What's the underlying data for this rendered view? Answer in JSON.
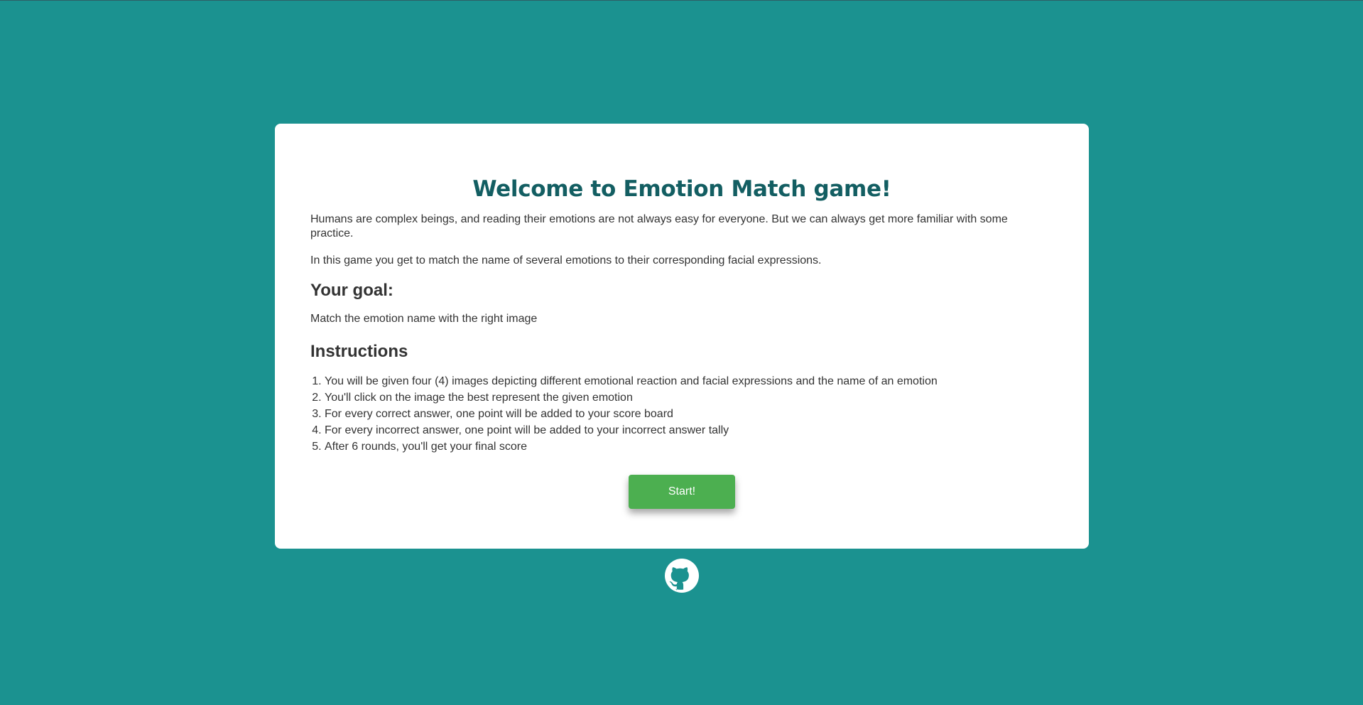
{
  "page": {
    "background_color": "#1b9290",
    "card_color": "#ffffff"
  },
  "intro": {
    "title": "Welcome to Emotion Match game!",
    "paragraph_1": "Humans are complex beings, and reading their emotions are not always easy for everyone. But we can always get more familiar with some practice.",
    "paragraph_2": "In this game you get to match the name of several emotions to their corresponding facial expressions."
  },
  "goal": {
    "heading": "Your goal:",
    "text": "Match the emotion name with the right image"
  },
  "instructions": {
    "heading": "Instructions",
    "items": [
      "You will be given four (4) images depicting different emotional reaction and facial expressions and the name of an emotion",
      "You'll click on the image the best represent the given emotion",
      "For every correct answer, one point will be added to your score board",
      "For every incorrect answer, one point will be added to your incorrect answer tally",
      "After 6 rounds, you'll get your final score"
    ]
  },
  "start_button": {
    "label": "Start!",
    "color": "#4caf50"
  },
  "footer": {
    "icon": "github-icon"
  }
}
